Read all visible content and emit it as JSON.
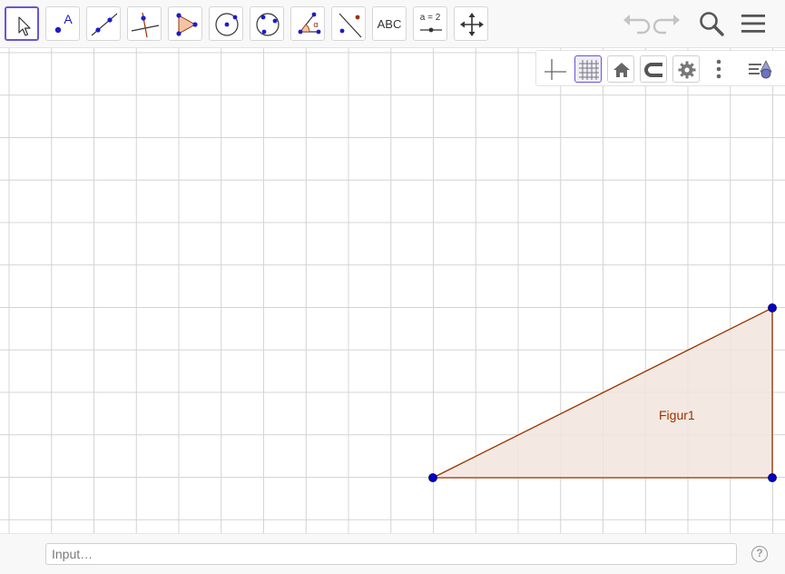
{
  "toolbar": {
    "tools": [
      {
        "id": "move",
        "icon": "move-pointer-icon",
        "selected": true
      },
      {
        "id": "point",
        "icon": "point-icon",
        "label": "A"
      },
      {
        "id": "line",
        "icon": "line-icon"
      },
      {
        "id": "perpendicular",
        "icon": "perpendicular-line-icon"
      },
      {
        "id": "polygon",
        "icon": "polygon-icon"
      },
      {
        "id": "circle",
        "icon": "circle-center-point-icon"
      },
      {
        "id": "conic",
        "icon": "circle-three-points-icon"
      },
      {
        "id": "angle",
        "icon": "angle-icon",
        "label": "α"
      },
      {
        "id": "reflect",
        "icon": "reflect-about-line-icon"
      },
      {
        "id": "text",
        "icon": "text-icon",
        "label": "ABC"
      },
      {
        "id": "slider",
        "icon": "slider-icon",
        "label": "a = 2"
      },
      {
        "id": "move-view",
        "icon": "move-graphics-view-icon"
      }
    ],
    "right": [
      "undo-icon",
      "redo-icon",
      "search-icon",
      "menu-icon"
    ]
  },
  "style_bar": {
    "buttons": [
      "show-axes-icon",
      "show-grid-icon",
      "home-icon",
      "point-capturing-icon",
      "settings-icon",
      "more-vert-icon",
      "toggle-style-bar-icon"
    ],
    "grid_active": true
  },
  "graphics": {
    "polygon_label": "Figur1",
    "polygon_fill": "#f2e4dd",
    "polygon_stroke": "#993300",
    "point_color": "#0000cc"
  },
  "input_bar": {
    "placeholder": "Input…",
    "help_label": "?"
  }
}
